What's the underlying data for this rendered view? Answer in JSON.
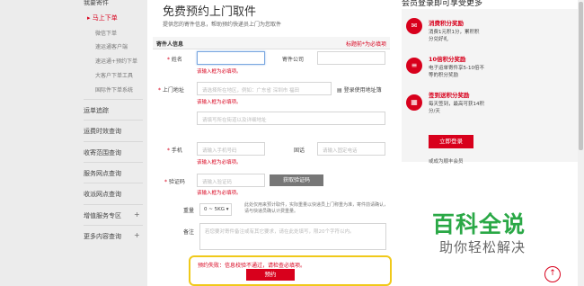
{
  "sidebar": {
    "top_header": "我要寄件",
    "active_item": "马上下单",
    "sub_items": [
      "微信下单",
      "速运通客户端",
      "速运通+预约下单",
      "大客户下单工具",
      "国际件下单系统"
    ],
    "sections": [
      "运单追踪",
      "运费时效查询",
      "收寄范围查询",
      "服务网点查询",
      "收派网点查询",
      "增值服务专区",
      "更多内容查询"
    ],
    "plus": "+"
  },
  "form": {
    "title": "免费预约上门取件",
    "subtitle": "提供您的寄件信息，帮助预约快递员上门为您取件",
    "section_title": "寄件人信息",
    "required_note": "标题前*为必填项",
    "star": "*",
    "name_label": "姓名",
    "name_error": "该输入框为必填项。",
    "company_label": "寄件公司",
    "address_label": "上门地址",
    "address_placeholder": "请选择所在地区，例如：广东省 深圳市 福田",
    "address_book": "登录使用地址簿",
    "address_error": "该输入框为必填项。",
    "detail_placeholder": "请填写所在街道以及详细地址",
    "mobile_label": "手机",
    "mobile_placeholder": "请输入手机号码",
    "mobile_error": "该输入框为必填项。",
    "phone_label": "固话",
    "phone_placeholder": "请输入固定电话",
    "code_label": "验证码",
    "code_placeholder": "请输入验证码",
    "code_button": "获取验证码",
    "code_error": "该输入框为必填项。",
    "weight_label": "重量",
    "weight_value": "0 ~ 5KG",
    "weight_note": "此处仅用来预计取件，实际重量以快递员上门称重为准，寄件前请确认，请与快递员确认计费重量。",
    "remark_label": "备注",
    "remark_placeholder": "若您要对寄件备注或有其它要求，请在此处填写，限20个字符以内。",
    "fail_message": "预约失败：信息校验不通过，请检查必填项。",
    "submit_label": "预约"
  },
  "right": {
    "title": "会员登录即可享受更多",
    "items": [
      {
        "icon": "gift-icon",
        "heading": "消费积分奖励",
        "text": "消费1元积1分，累积积分兑好礼"
      },
      {
        "icon": "list-icon",
        "heading": "10倍积分奖励",
        "text": "电子运单寄件享5-10倍不等的积分奖励"
      },
      {
        "icon": "calendar-icon",
        "heading": "签到送积分奖励",
        "text": "每天签到，最高可获14积分/天"
      }
    ],
    "login_button": "立即登录",
    "register_link": "或成为顺丰会员"
  },
  "watermark": {
    "big": "百科全说",
    "small": "助你轻松解决"
  },
  "colors": {
    "accent": "#d8001c",
    "watermark": "#2aa846",
    "highlight": "#f0c91a"
  }
}
